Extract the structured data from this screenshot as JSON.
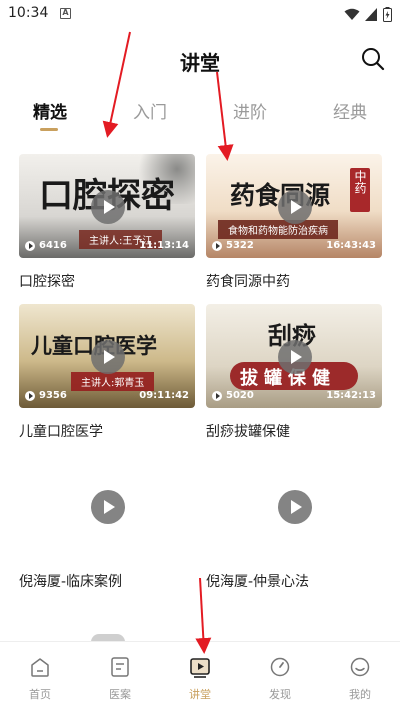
{
  "status": {
    "time": "10:34",
    "notif_badge": "A"
  },
  "header": {
    "title": "讲堂"
  },
  "tabs": [
    {
      "label": "精选",
      "active": true
    },
    {
      "label": "入门",
      "active": false
    },
    {
      "label": "进阶",
      "active": false
    },
    {
      "label": "经典",
      "active": false
    }
  ],
  "cards": [
    {
      "title": "口腔探密",
      "thumb_text": "口腔探密",
      "speaker": "主讲人:王予江",
      "views": "6416",
      "duration": "11:13:14"
    },
    {
      "title": "药食同源中药",
      "thumb_text": "药食同源",
      "badge": "中药",
      "subtitle": "食物和药物能防治疾病",
      "views": "5322",
      "duration": "16:43:43"
    },
    {
      "title": "儿童口腔医学",
      "thumb_text": "儿童口腔医学",
      "speaker": "主讲人:郭青玉",
      "views": "9356",
      "duration": "09:11:42"
    },
    {
      "title": "刮痧拔罐保健",
      "thumb_text": "刮痧",
      "thumb_text2": "拔罐保健",
      "views": "5020",
      "duration": "15:42:13"
    },
    {
      "title": "倪海厦-临床案例"
    },
    {
      "title": "倪海厦-仲景心法"
    }
  ],
  "bottom_nav": [
    {
      "label": "首页",
      "icon": "home-icon",
      "active": false
    },
    {
      "label": "医案",
      "icon": "document-icon",
      "active": false
    },
    {
      "label": "讲堂",
      "icon": "video-icon",
      "active": true
    },
    {
      "label": "发现",
      "icon": "compass-icon",
      "active": false
    },
    {
      "label": "我的",
      "icon": "smile-icon",
      "active": false
    }
  ],
  "colors": {
    "accent": "#c9a05e",
    "text": "#222222",
    "muted": "#999999",
    "annotation_arrow": "#e31b23"
  }
}
